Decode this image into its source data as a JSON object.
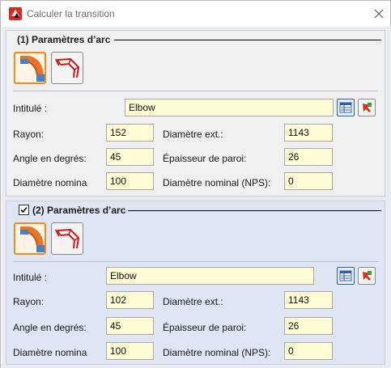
{
  "window": {
    "title": "Calculer la transition",
    "close_icon": "close-icon"
  },
  "group1": {
    "title": "(1) Paramètres d’arc",
    "has_checkbox": false,
    "labels": {
      "intitule": "Intitulé :",
      "rayon": "Rayon:",
      "angle": "Angle en degrés:",
      "diam_nomina": "Diamètre nomina",
      "diam_ext": "Diamètre ext.:",
      "epaisseur": "Épaisseur de paroi:",
      "diam_nps": "Diamètre nominal (NPS):"
    },
    "values": {
      "intitule": "Elbow",
      "rayon": "152",
      "angle": "45",
      "diam_nomina": "100",
      "diam_ext": "1143",
      "epaisseur": "26",
      "diam_nps": "0"
    }
  },
  "group2": {
    "title": "(2) Paramètres d’arc",
    "has_checkbox": true,
    "checked": true,
    "labels": {
      "intitule": "Intitulé :",
      "rayon": "Rayon:",
      "angle": "Angle en degrés:",
      "diam_nomina": "Diamètre nomina",
      "diam_ext": "Diamètre ext.:",
      "epaisseur": "Épaisseur de paroi:",
      "diam_nps": "Diamètre nominal (NPS):"
    },
    "values": {
      "intitule": "Elbow",
      "rayon": "102",
      "angle": "45",
      "diam_nomina": "100",
      "diam_ext": "1143",
      "epaisseur": "26",
      "diam_nps": "0"
    }
  },
  "colors": {
    "accent_orange": "#f08a1a",
    "field_bg": "#fffcd6",
    "group2_bg": "#dde6f2"
  }
}
